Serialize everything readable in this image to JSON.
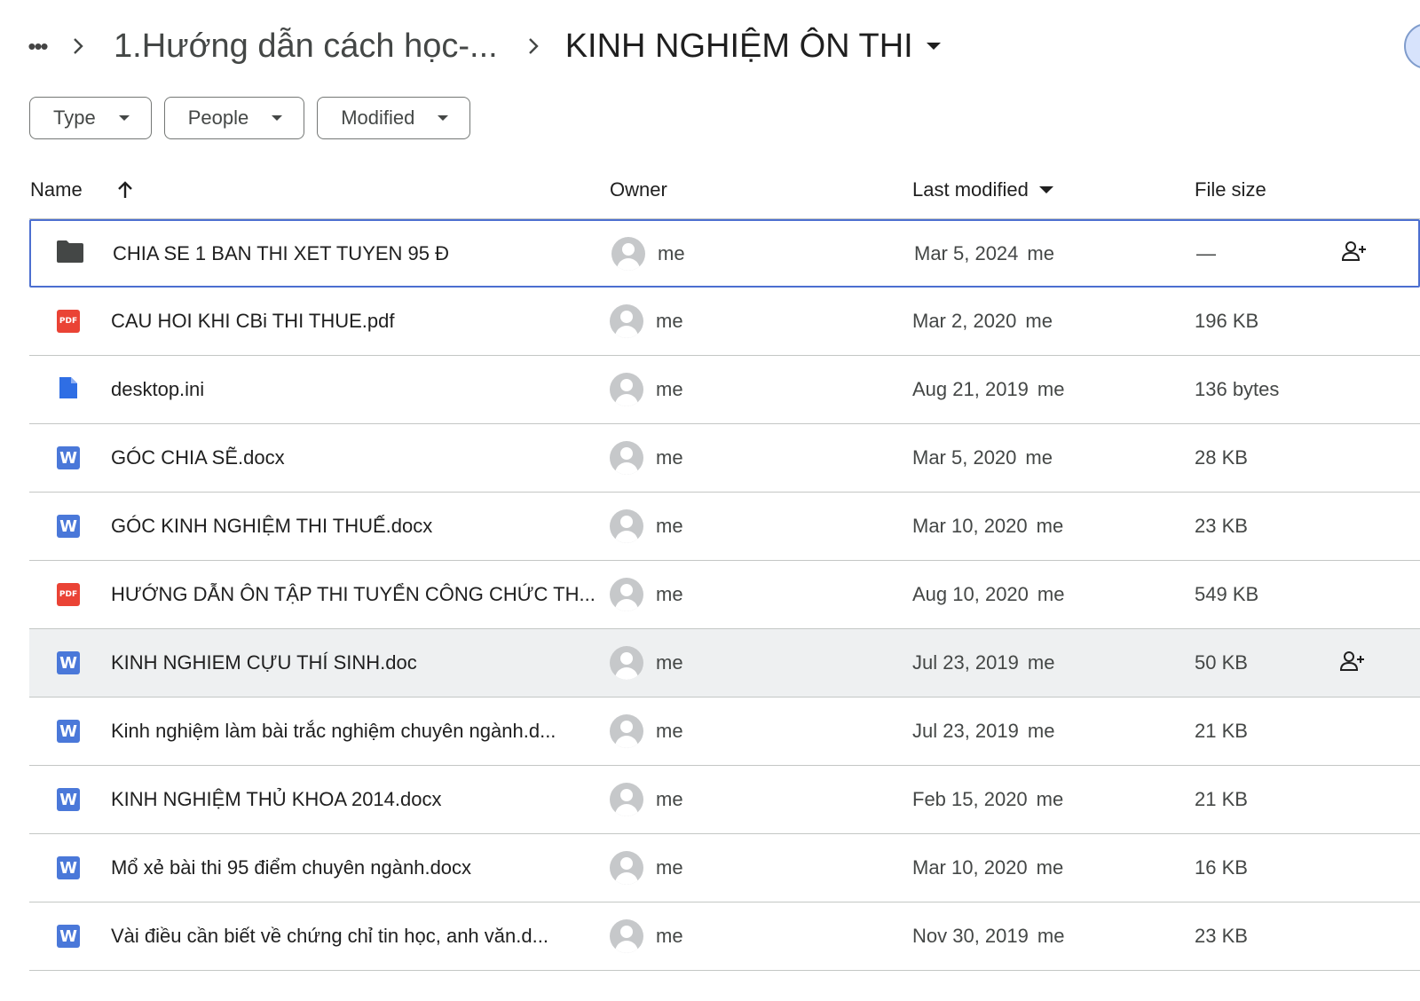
{
  "breadcrumb": {
    "more": "•••",
    "parent": "1.Hướng dẫn cách học-...",
    "current": "KINH NGHIỆM ÔN THI"
  },
  "filters": [
    {
      "label": "Type"
    },
    {
      "label": "People"
    },
    {
      "label": "Modified"
    }
  ],
  "columns": {
    "name": "Name",
    "owner": "Owner",
    "last_modified": "Last modified",
    "file_size": "File size"
  },
  "rows": [
    {
      "icon": "folder",
      "name": "CHIA SE 1 BAN THI XET TUYEN 95 Đ",
      "owner": "me",
      "date": "Mar 5, 2024",
      "by": "me",
      "size": "—",
      "share": true
    },
    {
      "icon": "pdf",
      "name": "CAU HOI KHI CBi THI THUE.pdf",
      "owner": "me",
      "date": "Mar 2, 2020",
      "by": "me",
      "size": "196 KB",
      "share": false
    },
    {
      "icon": "doc",
      "name": "desktop.ini",
      "owner": "me",
      "date": "Aug 21, 2019",
      "by": "me",
      "size": "136 bytes",
      "share": false
    },
    {
      "icon": "word",
      "name": "GÓC CHIA SẼ.docx",
      "owner": "me",
      "date": "Mar 5, 2020",
      "by": "me",
      "size": "28 KB",
      "share": false
    },
    {
      "icon": "word",
      "name": "GÓC KINH NGHIỆM THI THUẾ.docx",
      "owner": "me",
      "date": "Mar 10, 2020",
      "by": "me",
      "size": "23 KB",
      "share": false
    },
    {
      "icon": "pdf",
      "name": "HƯỚNG DẪN ÔN TẬP THI TUYỂN CÔNG CHỨC TH...",
      "owner": "me",
      "date": "Aug 10, 2020",
      "by": "me",
      "size": "549 KB",
      "share": false
    },
    {
      "icon": "word",
      "name": "KINH NGHIEM CỰU THÍ SINH.doc",
      "owner": "me",
      "date": "Jul 23, 2019",
      "by": "me",
      "size": "50 KB",
      "share": true
    },
    {
      "icon": "word",
      "name": "Kinh nghiệm làm bài trắc nghiệm chuyên ngành.d...",
      "owner": "me",
      "date": "Jul 23, 2019",
      "by": "me",
      "size": "21 KB",
      "share": false
    },
    {
      "icon": "word",
      "name": "KINH NGHIỆM THỦ KHOA 2014.docx",
      "owner": "me",
      "date": "Feb 15, 2020",
      "by": "me",
      "size": "21 KB",
      "share": false
    },
    {
      "icon": "word",
      "name": "Mổ xẻ bài thi 95 điểm chuyên ngành.docx",
      "owner": "me",
      "date": "Mar 10, 2020",
      "by": "me",
      "size": "16 KB",
      "share": false
    },
    {
      "icon": "word",
      "name": "Vài điều cần biết về chứng chỉ tin học, anh văn.d...",
      "owner": "me",
      "date": "Nov 30, 2019",
      "by": "me",
      "size": "23 KB",
      "share": false
    }
  ],
  "icon_labels": {
    "pdf": "PDF",
    "word": "W"
  },
  "colors": {
    "selection": "#4c6fd0",
    "pdf": "#ea4335",
    "word": "#4a78d9",
    "doc": "#2f6ee4",
    "folder": "#444746"
  }
}
